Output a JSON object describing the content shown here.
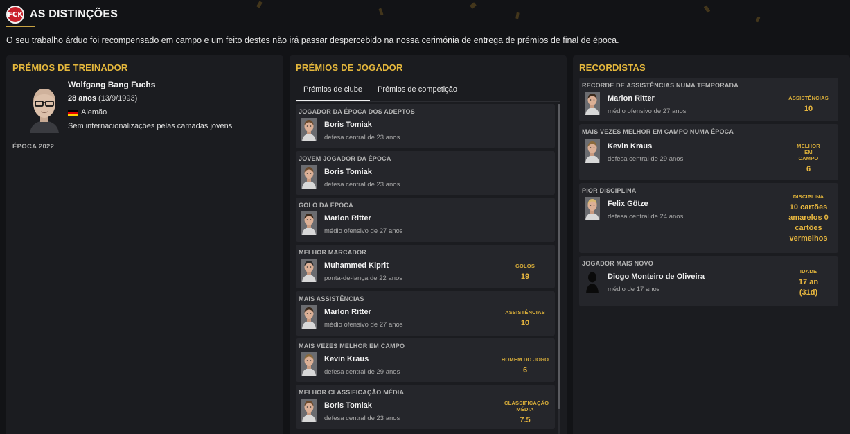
{
  "header": {
    "title": "AS DISTINÇÕES",
    "intro": "O seu trabalho árduo foi recompensado em campo e um feito destes não irá passar despercebido na nossa cerimónia de entrega de prémios de final de época.",
    "logo_text": "FCK"
  },
  "colors": {
    "accent": "#e4b73c",
    "background": "#121316",
    "panel": "#1b1c20",
    "card": "#25262b"
  },
  "coach": {
    "section_title": "PRÉMIOS DE TREINADOR",
    "name": "Wolfgang Bang Fuchs",
    "age": "28 anos",
    "birth": "(13/9/1993)",
    "nationality": "Alemão",
    "internationals": "Sem internacionalizações pelas camadas jovens",
    "season": "ÉPOCA 2022"
  },
  "player_awards": {
    "section_title": "PRÉMIOS DE JOGADOR",
    "tabs": [
      {
        "label": "Prémios de clube",
        "active": true
      },
      {
        "label": "Prémios de competição",
        "active": false
      }
    ],
    "items": [
      {
        "category": "JOGADOR DA ÉPOCA DOS ADEPTOS",
        "name": "Boris Tomiak",
        "desc": "defesa central de 23 anos",
        "stat_label": "",
        "stat_value": ""
      },
      {
        "category": "JOVEM JOGADOR DA ÉPOCA",
        "name": "Boris Tomiak",
        "desc": "defesa central de 23 anos",
        "stat_label": "",
        "stat_value": ""
      },
      {
        "category": "GOLO DA ÉPOCA",
        "name": "Marlon Ritter",
        "desc": "médio ofensivo de 27 anos",
        "stat_label": "",
        "stat_value": ""
      },
      {
        "category": "MELHOR MARCADOR",
        "name": "Muhammed Kiprit",
        "desc": "ponta-de-lança de 22 anos",
        "stat_label": "GOLOS",
        "stat_value": "19"
      },
      {
        "category": "MAIS ASSISTÊNCIAS",
        "name": "Marlon Ritter",
        "desc": "médio ofensivo de 27 anos",
        "stat_label": "ASSISTÊNCIAS",
        "stat_value": "10"
      },
      {
        "category": "MAIS VEZES MELHOR EM CAMPO",
        "name": "Kevin Kraus",
        "desc": "defesa central de 29 anos",
        "stat_label": "HOMEM DO JOGO",
        "stat_value": "6"
      },
      {
        "category": "MELHOR CLASSIFICAÇÃO MÉDIA",
        "name": "Boris Tomiak",
        "desc": "defesa central de 23 anos",
        "stat_label": "CLASSIFICAÇÃO MÉDIA",
        "stat_value": "7.5"
      }
    ]
  },
  "records": {
    "section_title": "RECORDISTAS",
    "items": [
      {
        "category": "RECORDE DE ASSISTÊNCIAS NUMA TEMPORADA",
        "name": "Marlon Ritter",
        "desc": "médio ofensivo de 27 anos",
        "stat_label": "ASSISTÊNCIAS",
        "stat_value": "10"
      },
      {
        "category": "MAIS VEZES MELHOR EM CAMPO NUMA ÉPOCA",
        "name": "Kevin Kraus",
        "desc": "defesa central de 29 anos",
        "stat_label": "MELHOR EM CAMPO",
        "stat_value": "6"
      },
      {
        "category": "PIOR DISCIPLINA",
        "name": "Felix Götze",
        "desc": "defesa central de 24 anos",
        "stat_label": "DISCIPLINA",
        "stat_value": "10 cartões amarelos 0 cartões vermelhos"
      },
      {
        "category": "JOGADOR MAIS NOVO",
        "name": "Diogo Monteiro de Oliveira",
        "desc": "médio de 17 anos",
        "stat_label": "IDADE",
        "stat_value": "17 an (31d)"
      }
    ]
  }
}
